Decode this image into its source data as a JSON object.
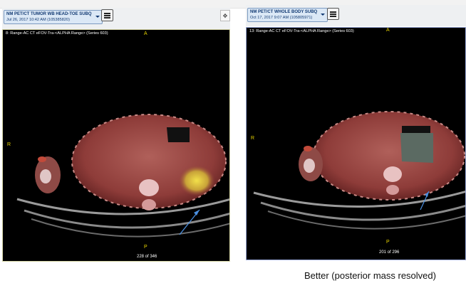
{
  "left_viewer": {
    "study_name": "NM PET/CT TUMOR WB HEAD-TOE SUBQ",
    "study_date": "Jul 26, 2017 10:42 AM (105385820)",
    "series_label": "8: Range-AC CT eFOV-Tra-<ALPHA Range> (Series 603)",
    "orientation": {
      "top": "A",
      "left": "R",
      "bottom": "P"
    },
    "counter": "228 of 346",
    "tool_icon": "pan-icon"
  },
  "right_viewer": {
    "study_name": "NM PET/CT WHOLE BODY SUBQ",
    "study_date": "Oct 17, 2017 9:07 AM (105805971)",
    "series_label": "13: Range-AC CT eFOV-Tra-<ALPHA Range> (Series 603)",
    "orientation": {
      "top": "A",
      "left": "R",
      "bottom": "P"
    },
    "counter": "201 of 296"
  },
  "caption": "Better (posterior  mass resolved)",
  "colors": {
    "arrow": "#4a8fe0",
    "orientation": "#e6d200",
    "header_text": "#123a73"
  }
}
